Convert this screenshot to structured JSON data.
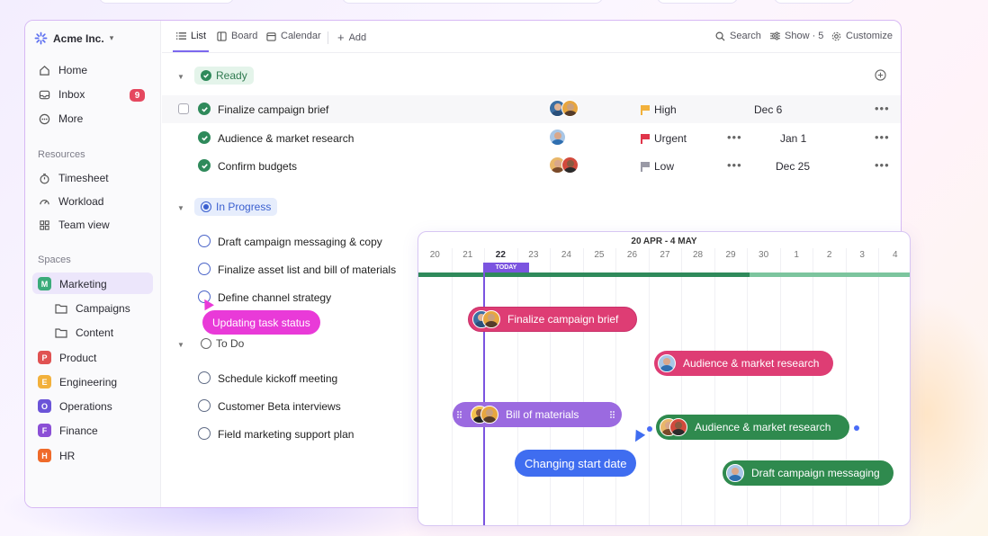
{
  "workspace": {
    "name": "Acme Inc."
  },
  "sidebar": {
    "nav": [
      {
        "label": "Home",
        "icon": "home-icon"
      },
      {
        "label": "Inbox",
        "icon": "inbox-icon",
        "badge": "9"
      },
      {
        "label": "More",
        "icon": "more-circle-icon"
      }
    ],
    "resources_title": "Resources",
    "resources": [
      {
        "label": "Timesheet",
        "icon": "stopwatch-icon"
      },
      {
        "label": "Workload",
        "icon": "gauge-icon"
      },
      {
        "label": "Team view",
        "icon": "grid-icon"
      }
    ],
    "spaces_title": "Spaces",
    "spaces": [
      {
        "label": "Marketing",
        "letter": "M",
        "color": "#3bab7a",
        "active": true
      },
      {
        "label": "Campaigns",
        "folder": true
      },
      {
        "label": "Content",
        "folder": true
      },
      {
        "label": "Product",
        "letter": "P",
        "color": "#e05252"
      },
      {
        "label": "Engineering",
        "letter": "E",
        "color": "#f2b13c"
      },
      {
        "label": "Operations",
        "letter": "O",
        "color": "#6b54d8"
      },
      {
        "label": "Finance",
        "letter": "F",
        "color": "#8b4fd6"
      },
      {
        "label": "HR",
        "letter": "H",
        "color": "#ef6a2a"
      }
    ]
  },
  "toolbar": {
    "views": [
      "List",
      "Board",
      "Calendar"
    ],
    "add": "Add",
    "search": "Search",
    "show": "Show · 5",
    "customize": "Customize"
  },
  "groups": {
    "ready": {
      "label": "Ready",
      "tasks": [
        {
          "name": "Finalize campaign brief",
          "priority": "High",
          "date": "Dec 6"
        },
        {
          "name": "Audience & market research",
          "priority": "Urgent",
          "date": "Jan 1"
        },
        {
          "name": "Confirm budgets",
          "priority": "Low",
          "date": "Dec 25"
        }
      ]
    },
    "in_progress": {
      "label": "In Progress",
      "tasks": [
        {
          "name": "Draft campaign messaging & copy"
        },
        {
          "name": "Finalize asset list and bill of materials"
        },
        {
          "name": "Define channel strategy"
        }
      ]
    },
    "todo": {
      "label": "To Do",
      "tasks": [
        {
          "name": "Schedule kickoff meeting"
        },
        {
          "name": "Customer Beta interviews"
        },
        {
          "name": "Field marketing support plan"
        }
      ]
    }
  },
  "colors": {
    "high": "#f2b13c",
    "urgent": "#e0354a",
    "low": "#9a9aa6",
    "accent": "#7b54e0"
  },
  "gantt": {
    "range": "20 APR - 4 MAY",
    "days": [
      "20",
      "21",
      "22",
      "23",
      "24",
      "25",
      "26",
      "27",
      "28",
      "29",
      "30",
      "1",
      "2",
      "3",
      "4"
    ],
    "today_label": "TODAY",
    "bars": [
      {
        "label": "Finalize campaign brief"
      },
      {
        "label": "Audience & market research"
      },
      {
        "label": "Bill of materials"
      },
      {
        "label": "Audience & market research"
      },
      {
        "label": "Draft campaign messaging"
      }
    ]
  },
  "toasts": {
    "pink": "Updating task status",
    "blue": "Changing start date"
  }
}
